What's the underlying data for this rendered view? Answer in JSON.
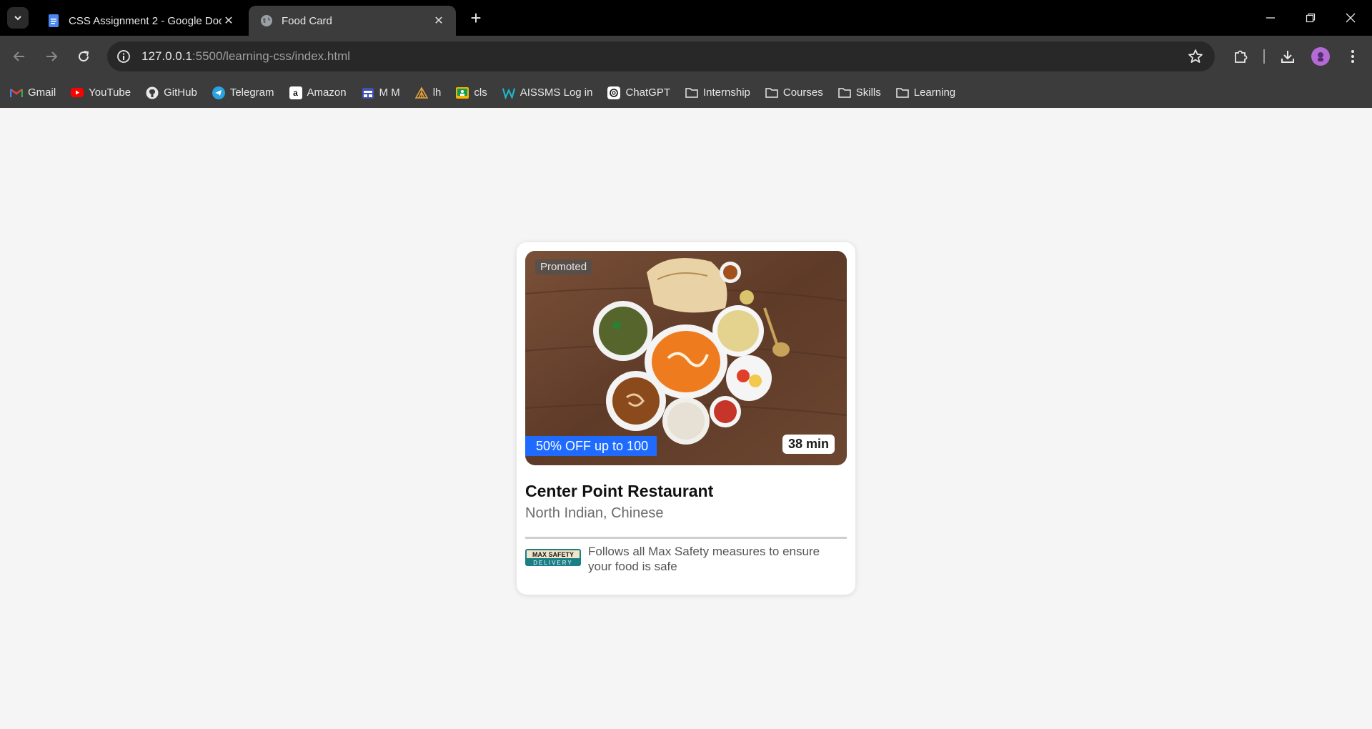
{
  "browser": {
    "tabs": [
      {
        "title": "CSS Assignment 2 - Google Docs",
        "icon": "google-docs-icon",
        "active": false
      },
      {
        "title": "Food Card",
        "icon": "globe-icon",
        "active": true
      }
    ],
    "url_host": "127.0.0.1",
    "url_path": ":5500/learning-css/index.html",
    "bookmarks": [
      {
        "label": "Gmail",
        "icon": "gmail-icon"
      },
      {
        "label": "YouTube",
        "icon": "youtube-icon"
      },
      {
        "label": "GitHub",
        "icon": "github-icon"
      },
      {
        "label": "Telegram",
        "icon": "telegram-icon"
      },
      {
        "label": "Amazon",
        "icon": "amazon-icon"
      },
      {
        "label": "M M",
        "icon": "calendar-icon"
      },
      {
        "label": "lh",
        "icon": "tent-icon"
      },
      {
        "label": "cls",
        "icon": "classroom-icon"
      },
      {
        "label": "AISSMS Log in",
        "icon": "w-logo-icon"
      },
      {
        "label": "ChatGPT",
        "icon": "chatgpt-icon"
      },
      {
        "label": "Internship",
        "icon": "folder-icon"
      },
      {
        "label": "Courses",
        "icon": "folder-icon"
      },
      {
        "label": "Skills",
        "icon": "folder-icon"
      },
      {
        "label": "Learning",
        "icon": "folder-icon"
      }
    ]
  },
  "card": {
    "promoted": "Promoted",
    "offer": "50% OFF up to 100",
    "eta": "38 min",
    "name": "Center Point Restaurant",
    "cuisine": "North Indian, Chinese",
    "safety_badge_top": "MAX SAFETY",
    "safety_badge_bottom": "DELIVERY",
    "safety_text": "Follows all Max Safety measures to ensure your food is safe"
  },
  "colors": {
    "offer_bg": "#1f6bff",
    "page_bg": "#f5f5f5",
    "card_bg": "#ffffff"
  }
}
